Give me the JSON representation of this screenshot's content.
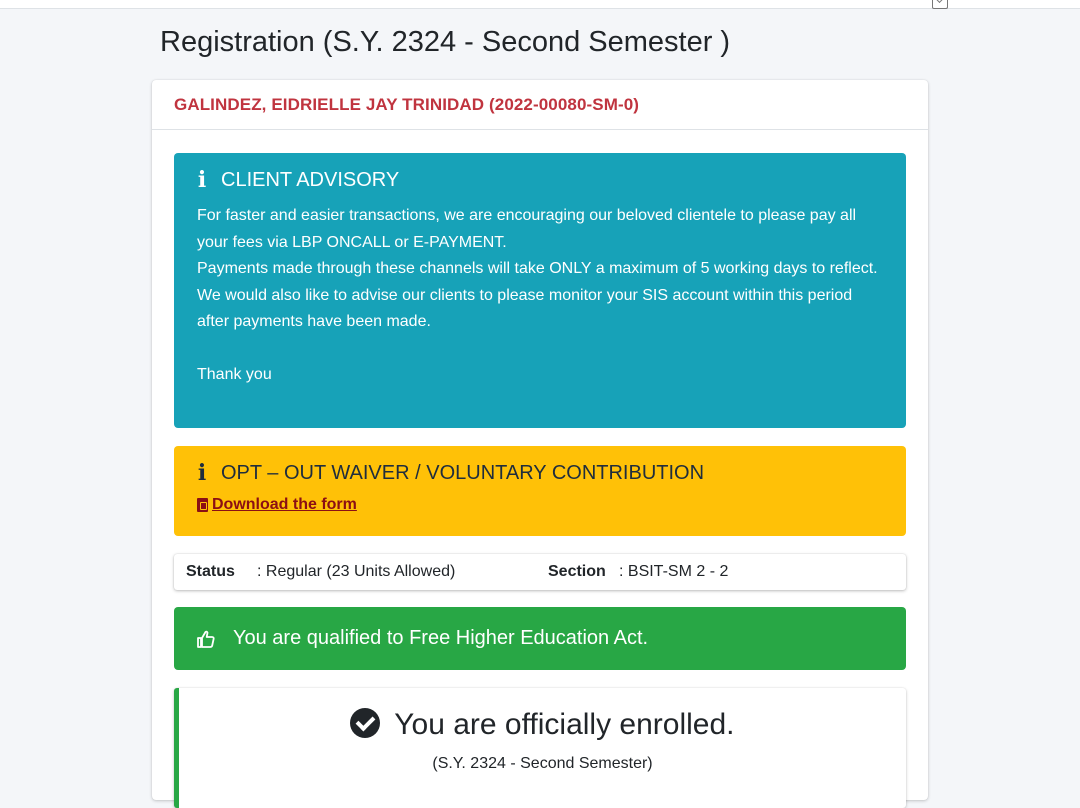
{
  "page": {
    "title": "Registration (S.Y. 2324 - Second Semester )"
  },
  "student": {
    "name": "GALINDEZ, EIDRIELLE JAY TRINIDAD (2022-00080-SM-0)"
  },
  "advisory": {
    "heading": "CLIENT ADVISORY",
    "line1": "For faster and easier transactions, we are encouraging our beloved clientele to please pay all your fees via LBP ONCALL or E-PAYMENT.",
    "line2": "Payments made through these channels will take ONLY a maximum of 5 working days to reflect.",
    "line3": "We would also like to advise our clients to please monitor your SIS account within this period after payments have been made.",
    "thanks": "Thank you"
  },
  "waiver": {
    "heading": "OPT – OUT WAIVER / VOLUNTARY CONTRIBUTION",
    "download_label": "Download the form"
  },
  "status": {
    "status_label": "Status",
    "status_value": ": Regular (23 Units Allowed)",
    "section_label": "Section",
    "section_value": ": BSIT-SM 2 - 2"
  },
  "qualification": {
    "message": "You are qualified to Free Higher Education Act."
  },
  "enrollment": {
    "message": "You are officially enrolled.",
    "term": "(S.Y. 2324 - Second Semester)"
  },
  "colors": {
    "info": "#17a2b8",
    "warning": "#ffc107",
    "success": "#28a745",
    "name": "#c0343f",
    "link": "#8b0f14"
  },
  "icons": {
    "advisory": "info-icon",
    "waiver": "info-icon",
    "download": "file-pdf-icon",
    "qualification": "thumbs-up-icon",
    "enrollment": "check-circle-icon"
  }
}
